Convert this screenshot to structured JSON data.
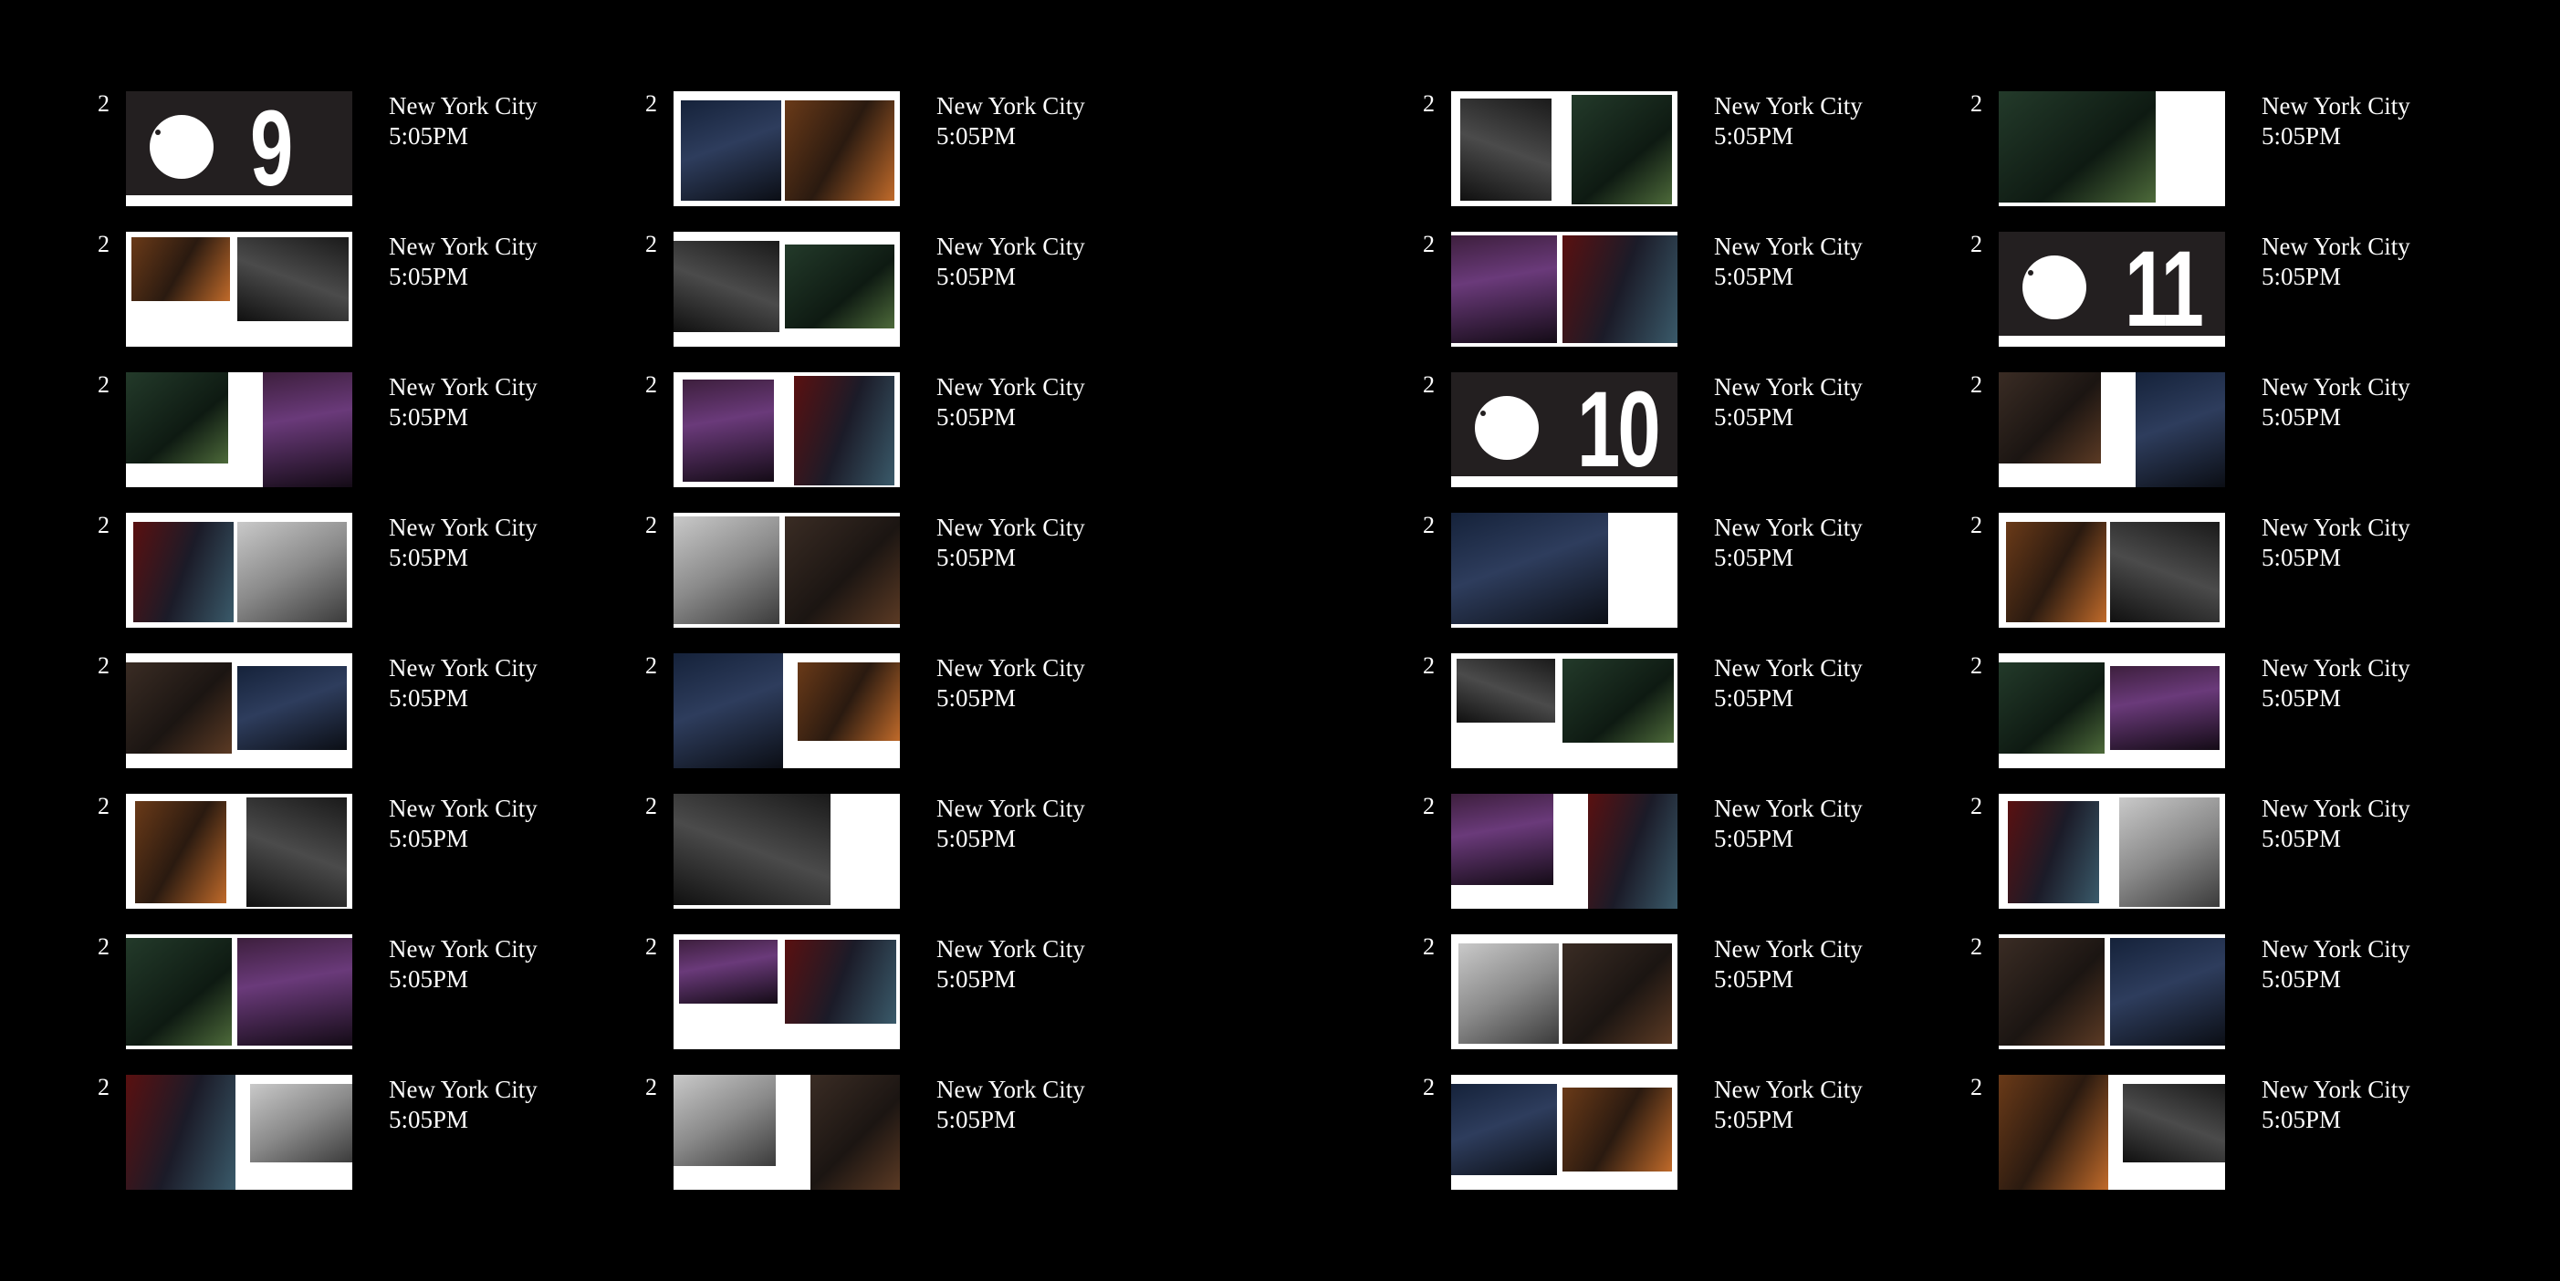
{
  "spreads": [
    {
      "columns": [
        {
          "entries": [
            {
              "page": "2",
              "location": "New York City",
              "time": "5:05PM",
              "kind": "divider",
              "divider_number": "9"
            },
            {
              "page": "2",
              "location": "New York City",
              "time": "5:05PM"
            },
            {
              "page": "2",
              "location": "New York City",
              "time": "5:05PM"
            },
            {
              "page": "2",
              "location": "New York City",
              "time": "5:05PM"
            },
            {
              "page": "2",
              "location": "New York City",
              "time": "5:05PM"
            },
            {
              "page": "2",
              "location": "New York City",
              "time": "5:05PM"
            },
            {
              "page": "2",
              "location": "New York City",
              "time": "5:05PM"
            },
            {
              "page": "2",
              "location": "New York City",
              "time": "5:05PM"
            }
          ]
        },
        {
          "entries": [
            {
              "page": "2",
              "location": "New York City",
              "time": "5:05PM"
            },
            {
              "page": "2",
              "location": "New York City",
              "time": "5:05PM"
            },
            {
              "page": "2",
              "location": "New York City",
              "time": "5:05PM"
            },
            {
              "page": "2",
              "location": "New York City",
              "time": "5:05PM"
            },
            {
              "page": "2",
              "location": "New York City",
              "time": "5:05PM"
            },
            {
              "page": "2",
              "location": "New York City",
              "time": "5:05PM"
            },
            {
              "page": "2",
              "location": "New York City",
              "time": "5:05PM"
            },
            {
              "page": "2",
              "location": "New York City",
              "time": "5:05PM"
            }
          ]
        }
      ]
    },
    {
      "columns": [
        {
          "entries": [
            {
              "page": "2",
              "location": "New York City",
              "time": "5:05PM"
            },
            {
              "page": "2",
              "location": "New York City",
              "time": "5:05PM"
            },
            {
              "page": "2",
              "location": "New York City",
              "time": "5:05PM",
              "kind": "divider",
              "divider_number": "10"
            },
            {
              "page": "2",
              "location": "New York City",
              "time": "5:05PM"
            },
            {
              "page": "2",
              "location": "New York City",
              "time": "5:05PM"
            },
            {
              "page": "2",
              "location": "New York City",
              "time": "5:05PM"
            },
            {
              "page": "2",
              "location": "New York City",
              "time": "5:05PM"
            },
            {
              "page": "2",
              "location": "New York City",
              "time": "5:05PM"
            }
          ]
        },
        {
          "entries": [
            {
              "page": "2",
              "location": "New York City",
              "time": "5:05PM"
            },
            {
              "page": "2",
              "location": "New York City",
              "time": "5:05PM",
              "kind": "divider",
              "divider_number": "11"
            },
            {
              "page": "2",
              "location": "New York City",
              "time": "5:05PM"
            },
            {
              "page": "2",
              "location": "New York City",
              "time": "5:05PM"
            },
            {
              "page": "2",
              "location": "New York City",
              "time": "5:05PM"
            },
            {
              "page": "2",
              "location": "New York City",
              "time": "5:05PM"
            },
            {
              "page": "2",
              "location": "New York City",
              "time": "5:05PM"
            },
            {
              "page": "2",
              "location": "New York City",
              "time": "5:05PM"
            }
          ]
        }
      ]
    }
  ],
  "colors": {
    "background": "#000000",
    "page": "#ffffff",
    "divider": "#231f20",
    "text": "#ffffff"
  }
}
